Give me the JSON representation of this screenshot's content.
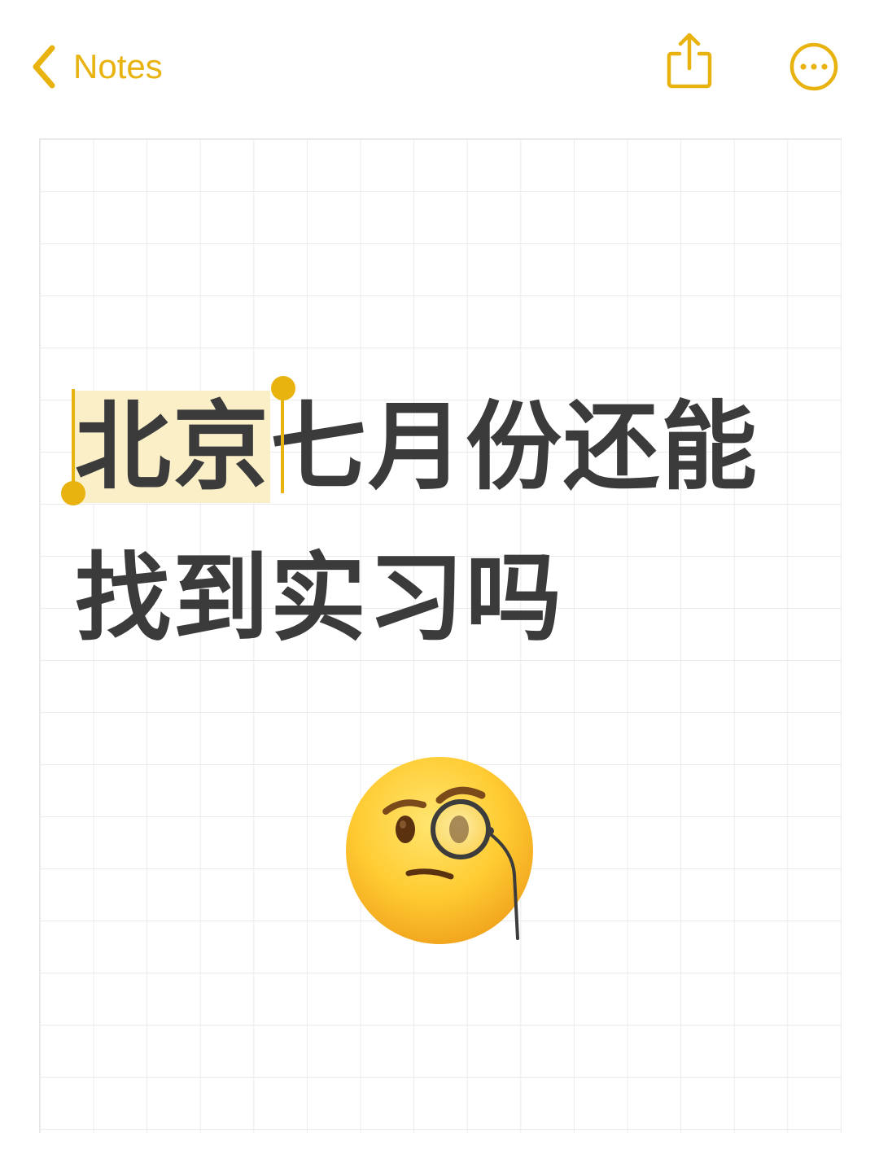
{
  "nav": {
    "back_label": "Notes",
    "share_icon": "share-icon",
    "more_icon": "ellipsis-circle-icon"
  },
  "note": {
    "selected_text": "北京",
    "line1_rest": "七月份还能",
    "line2": "找到实习吗",
    "emoji": "face-with-monocle-emoji"
  },
  "colors": {
    "accent": "#E8B20F",
    "text": "#3b3b3b",
    "selection": "#FBEFC8",
    "grid": "#ebebeb"
  }
}
